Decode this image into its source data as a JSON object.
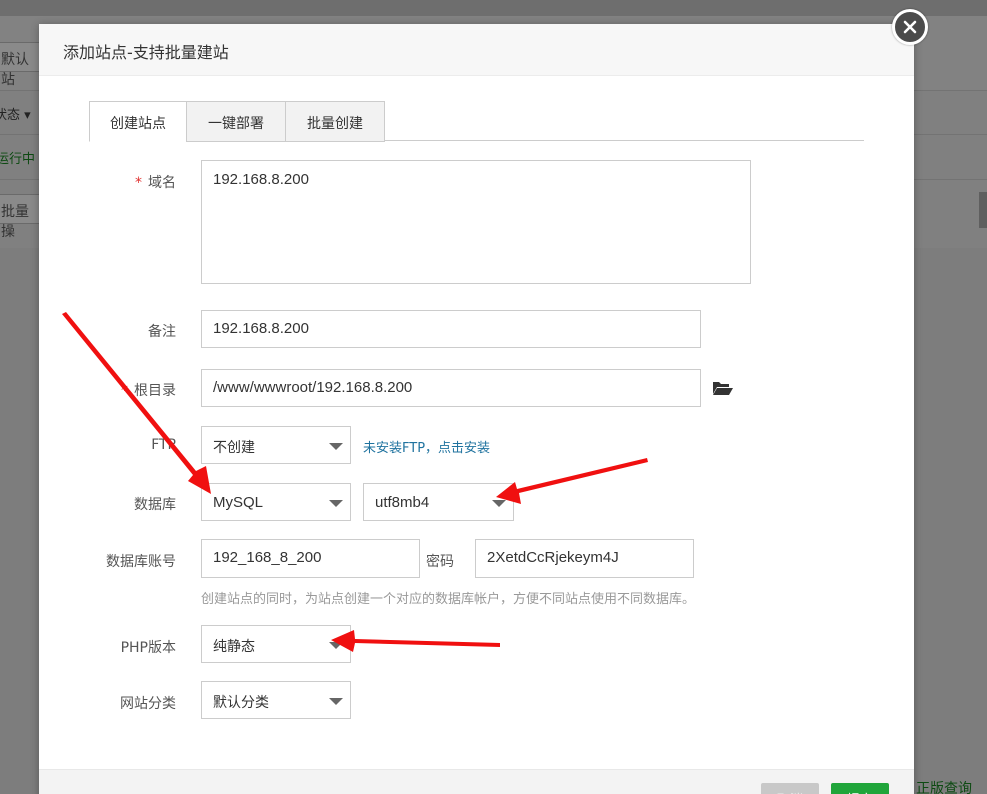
{
  "background": {
    "default_site_btn": "默认站",
    "status_filter": "状态",
    "running_status": "运行中",
    "batch_ops": "批量操",
    "footer_link": "正版查询"
  },
  "modal": {
    "title": "添加站点-支持批量建站",
    "tabs": [
      {
        "label": "创建站点"
      },
      {
        "label": "一键部署"
      },
      {
        "label": "批量创建"
      }
    ],
    "form": {
      "domain": {
        "label": "域名",
        "value": "192.168.8.200"
      },
      "remark": {
        "label": "备注",
        "value": "192.168.8.200"
      },
      "root": {
        "label": "根目录",
        "value": "/www/wwwroot/192.168.8.200"
      },
      "ftp": {
        "label": "FTP",
        "selected": "不创建",
        "link": "未安装FTP，点击安装"
      },
      "database": {
        "label": "数据库",
        "selected": "MySQL",
        "charset": "utf8mb4"
      },
      "db_account": {
        "label": "数据库账号",
        "value": "192_168_8_200",
        "password_label": "密码",
        "password_value": "2XetdCcRjekeym4J",
        "hint": "创建站点的同时，为站点创建一个对应的数据库帐户，方便不同站点使用不同数据库。"
      },
      "php_version": {
        "label": "PHP版本",
        "selected": "纯静态"
      },
      "category": {
        "label": "网站分类",
        "selected": "默认分类"
      }
    },
    "footer": {
      "cancel_label": "取消",
      "submit_label": "提交"
    }
  },
  "colors": {
    "accent_green": "#20a53a",
    "link_blue": "#20739f",
    "required_red": "#e0302f",
    "arrow_red": "#f01010"
  }
}
